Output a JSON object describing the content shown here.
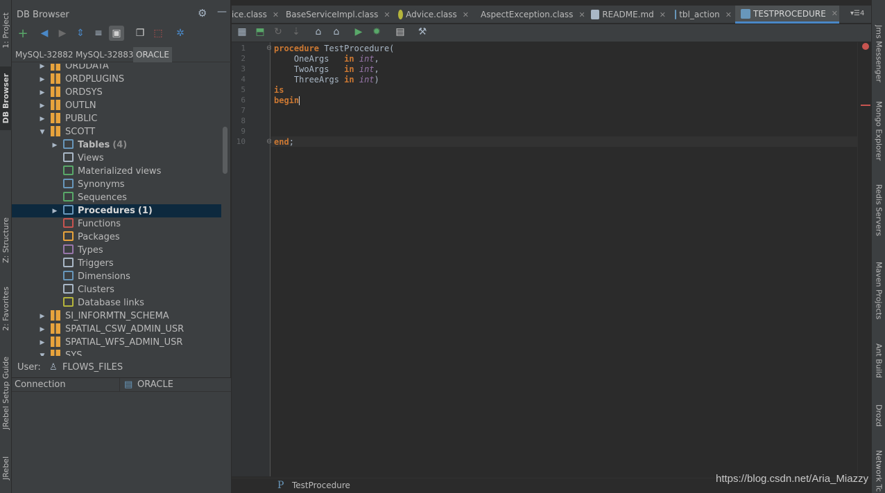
{
  "left_rail": {
    "tabs": [
      {
        "label": "1: Project"
      },
      {
        "label": "DB Browser"
      },
      {
        "label": "Z: Structure"
      },
      {
        "label": "2: Favorites"
      },
      {
        "label": "JRebel Setup Guide"
      },
      {
        "label": "JRebel"
      }
    ]
  },
  "right_rail": {
    "tabs": [
      {
        "label": "Jms Messenger"
      },
      {
        "label": "Mongo Explorer"
      },
      {
        "label": "Redis Servers"
      },
      {
        "label": "Maven Projects"
      },
      {
        "label": "Ant Build"
      },
      {
        "label": "Drozd"
      },
      {
        "label": "Network Tc"
      }
    ]
  },
  "db_browser": {
    "title": "DB Browser",
    "connections": [
      "MySQL-32882",
      "MySQL-32883",
      "ORACLE"
    ],
    "selected_connection": "ORACLE",
    "tree": [
      {
        "label": "ORDDATA",
        "icon": "schema-icon",
        "level": 1,
        "expand": "collapsed"
      },
      {
        "label": "ORDPLUGINS",
        "icon": "schema-icon",
        "level": 1,
        "expand": "collapsed"
      },
      {
        "label": "ORDSYS",
        "icon": "schema-icon",
        "level": 1,
        "expand": "collapsed"
      },
      {
        "label": "OUTLN",
        "icon": "schema-icon",
        "level": 1,
        "expand": "collapsed"
      },
      {
        "label": "PUBLIC",
        "icon": "schema-icon",
        "level": 1,
        "expand": "collapsed"
      },
      {
        "label": "SCOTT",
        "icon": "schema-icon",
        "level": 1,
        "expand": "expanded"
      },
      {
        "label": "Tables",
        "count": "(4)",
        "icon": "tables-icon",
        "level": 2,
        "expand": "collapsed",
        "bold": true
      },
      {
        "label": "Views",
        "icon": "views-icon",
        "level": 2,
        "expand": "none"
      },
      {
        "label": "Materialized views",
        "icon": "materialized-views-icon",
        "level": 2,
        "expand": "none"
      },
      {
        "label": "Synonyms",
        "icon": "synonyms-icon",
        "level": 2,
        "expand": "none"
      },
      {
        "label": "Sequences",
        "icon": "sequences-icon",
        "level": 2,
        "expand": "none"
      },
      {
        "label": "Procedures",
        "count": "(1)",
        "icon": "procedures-icon",
        "level": 2,
        "expand": "collapsed",
        "bold": true,
        "selected": true
      },
      {
        "label": "Functions",
        "icon": "functions-icon",
        "level": 2,
        "expand": "none"
      },
      {
        "label": "Packages",
        "icon": "packages-icon",
        "level": 2,
        "expand": "none"
      },
      {
        "label": "Types",
        "icon": "types-icon",
        "level": 2,
        "expand": "none"
      },
      {
        "label": "Triggers",
        "icon": "triggers-icon",
        "level": 2,
        "expand": "none"
      },
      {
        "label": "Dimensions",
        "icon": "dimensions-icon",
        "level": 2,
        "expand": "none"
      },
      {
        "label": "Clusters",
        "icon": "clusters-icon",
        "level": 2,
        "expand": "none"
      },
      {
        "label": "Database links",
        "icon": "database-links-icon",
        "level": 2,
        "expand": "none"
      },
      {
        "label": "SI_INFORMTN_SCHEMA",
        "icon": "schema-icon",
        "level": 1,
        "expand": "collapsed"
      },
      {
        "label": "SPATIAL_CSW_ADMIN_USR",
        "icon": "schema-icon",
        "level": 1,
        "expand": "collapsed"
      },
      {
        "label": "SPATIAL_WFS_ADMIN_USR",
        "icon": "schema-icon",
        "level": 1,
        "expand": "collapsed"
      },
      {
        "label": "SYS",
        "icon": "schema-icon",
        "level": 1,
        "expand": "expanded"
      }
    ],
    "user_label": "User:",
    "user_value": "FLOWS_FILES",
    "props_key": "Connection",
    "props_value": "ORACLE"
  },
  "editor_tabs": [
    {
      "label": "ice.class",
      "icon": "class-icon"
    },
    {
      "label": "BaseServiceImpl.class",
      "icon": "class-icon"
    },
    {
      "label": "Advice.class",
      "icon": "aspect-class-icon"
    },
    {
      "label": "AspectException.class",
      "icon": "class-icon"
    },
    {
      "label": "README.md",
      "icon": "markdown-icon"
    },
    {
      "label": "tbl_action",
      "icon": "table-icon"
    },
    {
      "label": "TESTPROCEDURE",
      "icon": "procedure-icon",
      "active": true
    }
  ],
  "editor_tabs_overflow": "4",
  "code": {
    "line_numbers": [
      "1",
      "2",
      "3",
      "4",
      "5",
      "6",
      "7",
      "8",
      "9",
      "10"
    ],
    "lines": [
      [
        {
          "t": "procedure",
          "c": "kw"
        },
        {
          "t": " TestProcedure(",
          "c": ""
        }
      ],
      [
        {
          "t": "    OneArgs   ",
          "c": ""
        },
        {
          "t": "in",
          "c": "kw"
        },
        {
          "t": " ",
          "c": ""
        },
        {
          "t": "int",
          "c": "ty"
        },
        {
          "t": ",",
          "c": ""
        }
      ],
      [
        {
          "t": "    TwoArgs   ",
          "c": ""
        },
        {
          "t": "in",
          "c": "kw"
        },
        {
          "t": " ",
          "c": ""
        },
        {
          "t": "int",
          "c": "ty"
        },
        {
          "t": ",",
          "c": ""
        }
      ],
      [
        {
          "t": "    ThreeArgs ",
          "c": ""
        },
        {
          "t": "in",
          "c": "kw"
        },
        {
          "t": " ",
          "c": ""
        },
        {
          "t": "int",
          "c": "ty"
        },
        {
          "t": ")",
          "c": ""
        }
      ],
      [
        {
          "t": "is",
          "c": "kw"
        }
      ],
      [
        {
          "t": "begin",
          "c": "kw"
        }
      ],
      [],
      [],
      [],
      [
        {
          "t": "end",
          "c": "kw"
        },
        {
          "t": ";",
          "c": ""
        }
      ]
    ]
  },
  "breadcrumb": {
    "label": "TestProcedure"
  },
  "watermark": "https://blog.csdn.net/Aria_Miazzy"
}
